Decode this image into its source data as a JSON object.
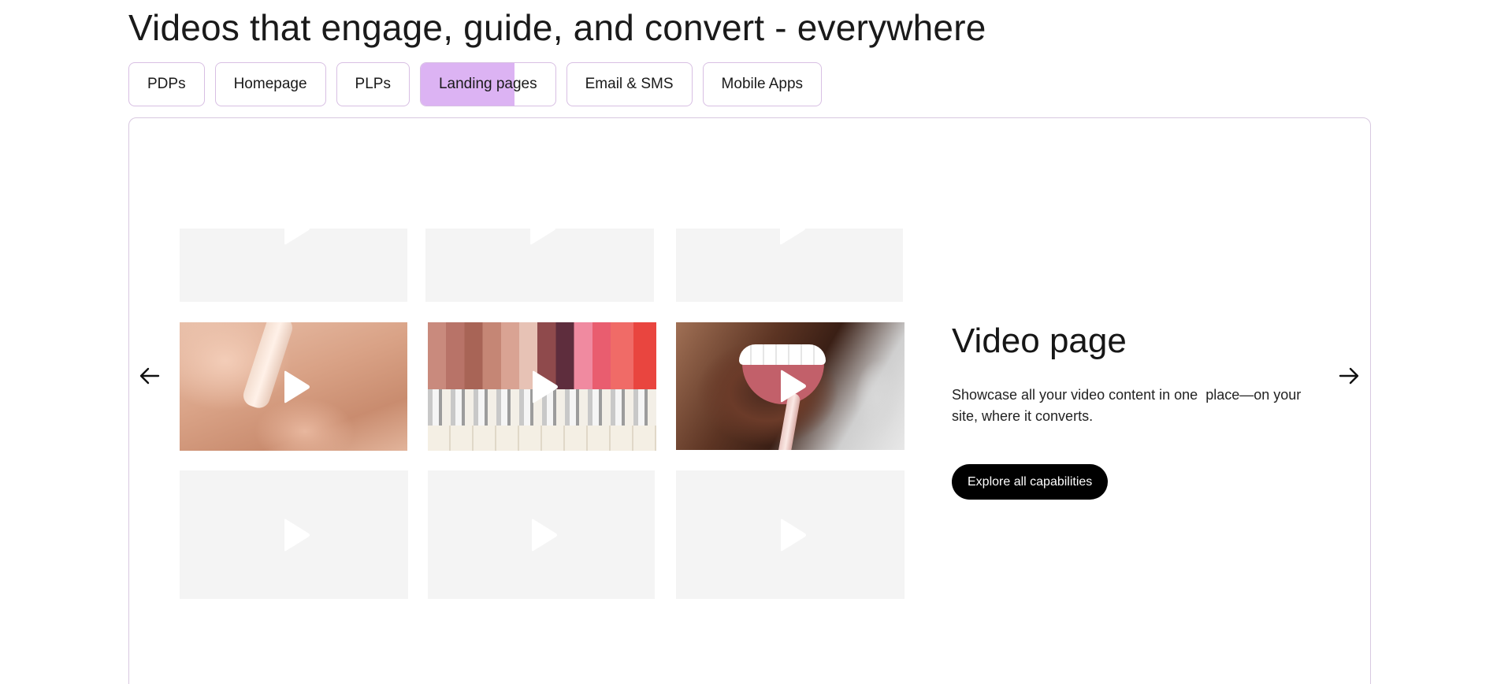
{
  "heading": "Videos that engage, guide, and convert - everywhere",
  "tabs": [
    {
      "label": "PDPs",
      "active": false
    },
    {
      "label": "Homepage",
      "active": false
    },
    {
      "label": "PLPs",
      "active": false
    },
    {
      "label": "Landing pages",
      "active": true,
      "progress_percent": 70
    },
    {
      "label": "Email & SMS",
      "active": false
    },
    {
      "label": "Mobile Apps",
      "active": false
    }
  ],
  "carousel": {
    "prev_icon": "arrow-left-icon",
    "next_icon": "arrow-right-icon",
    "grid": {
      "rows": [
        [
          "placeholder",
          "placeholder",
          "placeholder"
        ],
        [
          "foundation-dropper",
          "lipstick-lineup",
          "lip-gloss-smile"
        ],
        [
          "placeholder",
          "placeholder",
          "placeholder"
        ]
      ],
      "play_icon": "play-icon"
    },
    "slide": {
      "title": "Video page",
      "description": "Showcase all your video content in one  place—on your site, where it converts.",
      "cta_label": "Explore all capabilities"
    }
  },
  "colors": {
    "tab_border": "#d8bfe3",
    "tab_active_fill": "#dcb3f3",
    "panel_border": "#d8c8e0",
    "placeholder_tile": "#f4f4f4",
    "cta_background": "#000000",
    "cta_text": "#ffffff"
  }
}
